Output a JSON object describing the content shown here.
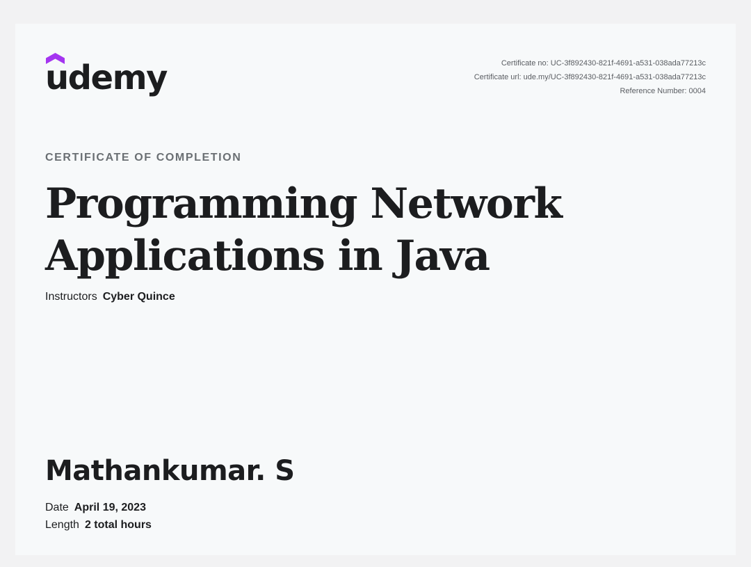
{
  "brand": {
    "logo_text": "udemy",
    "logo_mark": "purple-chevron-roof",
    "accent_color": "#a435f0"
  },
  "certificate": {
    "certificate_no": "Certificate no: UC-3f892430-821f-4691-a531-038ada77213c",
    "certificate_url": "Certificate url: ude.my/UC-3f892430-821f-4691-a531-038ada77213c",
    "reference_number": "Reference Number: 0004",
    "heading": "CERTIFICATE OF COMPLETION",
    "course_title": "Programming Network Applications in Java",
    "instructors_label": "Instructors",
    "instructors_value": "Cyber Quince",
    "student_name": "Mathankumar. S",
    "date_label": "Date",
    "date_value": "April 19, 2023",
    "length_label": "Length",
    "length_value": "2 total hours"
  }
}
